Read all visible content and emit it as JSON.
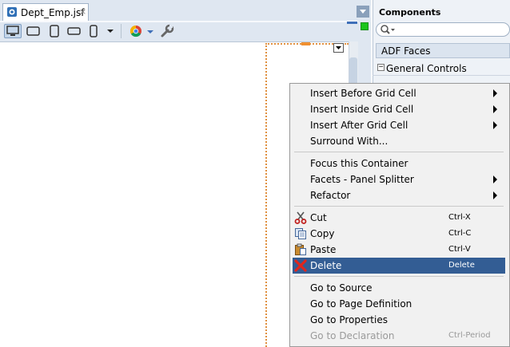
{
  "editor": {
    "tab_title": "Dept_Emp.jsf",
    "tab_close": "×",
    "toolbar_icons": [
      "desktop-view-icon",
      "tablet-landscape-icon",
      "tablet-portrait-icon",
      "phone-landscape-icon",
      "phone-portrait-icon",
      "dropdown-icon",
      "chrome-browser-icon",
      "dropdown-icon",
      "wrench-icon"
    ]
  },
  "components_panel": {
    "title": "Components",
    "search_placeholder": "",
    "category": "ADF Faces",
    "section_toggle": "−",
    "section": "General Controls"
  },
  "context_menu": {
    "groups": [
      [
        {
          "label": "Insert Before Grid Cell",
          "submenu": true
        },
        {
          "label": "Insert Inside Grid Cell",
          "submenu": true
        },
        {
          "label": "Insert After Grid Cell",
          "submenu": true
        },
        {
          "label": "Surround With...",
          "submenu": false
        }
      ],
      [
        {
          "label": "Focus this Container",
          "submenu": false
        },
        {
          "label": "Facets - Panel Splitter",
          "submenu": true
        },
        {
          "label": "Refactor",
          "submenu": true
        }
      ],
      [
        {
          "label": "Cut",
          "shortcut": "Ctrl-X",
          "icon": "scissors-icon"
        },
        {
          "label": "Copy",
          "shortcut": "Ctrl-C",
          "icon": "copy-icon"
        },
        {
          "label": "Paste",
          "shortcut": "Ctrl-V",
          "icon": "paste-icon"
        },
        {
          "label": "Delete",
          "shortcut": "Delete",
          "icon": "delete-icon",
          "highlighted": true
        }
      ],
      [
        {
          "label": "Go to Source",
          "shortcut": ""
        },
        {
          "label": "Go to Page Definition",
          "shortcut": ""
        },
        {
          "label": "Go to Properties",
          "shortcut": ""
        },
        {
          "label": "Go to Declaration",
          "shortcut": "Ctrl-Period",
          "disabled": true
        }
      ]
    ]
  },
  "colors": {
    "highlight": "#335d94",
    "selection_border": "#e09040",
    "chrome": "#dfe7f1"
  }
}
